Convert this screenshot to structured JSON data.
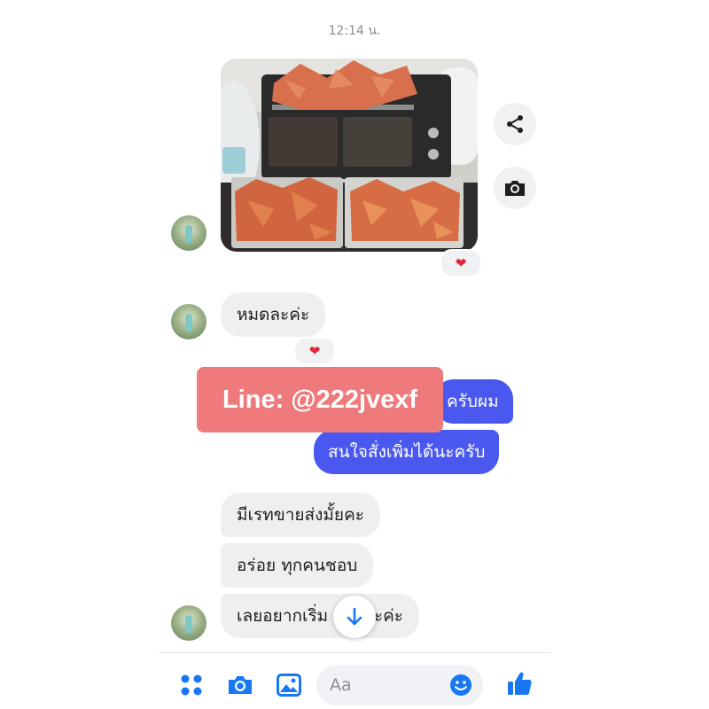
{
  "chat": {
    "timestamp": "12:14 น.",
    "messages": [
      {
        "kind": "image",
        "reaction": "heart"
      },
      {
        "kind": "incoming",
        "text": "หมดละค่ะ",
        "reaction": "heart"
      },
      {
        "kind": "outgoing",
        "text": "ครับผม"
      },
      {
        "kind": "outgoing",
        "text": "สนใจสั่งเพิ่มได้นะครับ"
      },
      {
        "kind": "incoming",
        "text": "มีเรทขายส่งมั้ยคะ"
      },
      {
        "kind": "incoming",
        "text": "อร่อย ทุกคนชอบ"
      },
      {
        "kind": "incoming",
        "text_left": "เลยอยากเริ่ม",
        "text_right": "ละค่ะ"
      }
    ]
  },
  "watermark": {
    "text": "Line: @222jvexf"
  },
  "composer": {
    "placeholder": "Aa"
  },
  "icons": [
    "share-icon",
    "camera-icon",
    "heart-icon",
    "arrow-down-icon",
    "apps-icon",
    "camera-icon",
    "gallery-icon",
    "emoji-icon",
    "like-icon"
  ],
  "colors": {
    "outgoing_bubble": "#4a58f0",
    "accent": "#1877f2",
    "reaction": "#e02838",
    "watermark_bg": "#ef7a7c"
  }
}
